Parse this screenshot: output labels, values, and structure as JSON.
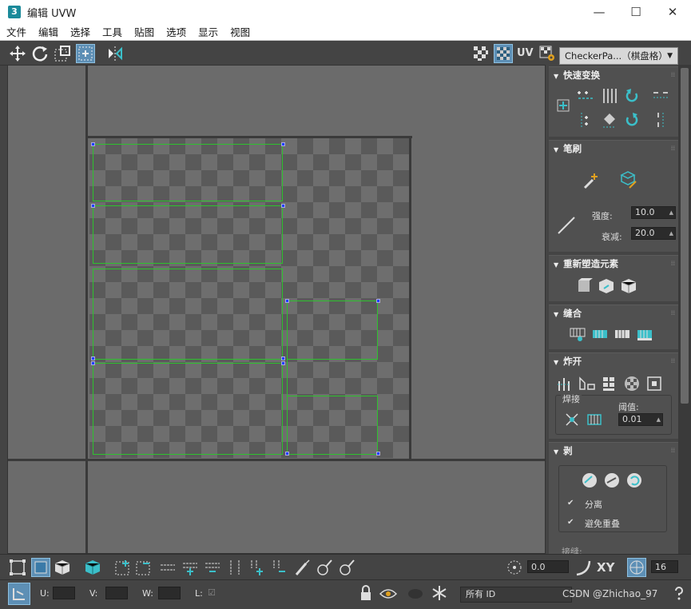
{
  "window": {
    "app_icon_label": "3",
    "title": "编辑 UVW",
    "controls": {
      "minimize": "—",
      "maximize": "☐",
      "close": "✕"
    }
  },
  "menu": [
    "文件",
    "编辑",
    "选择",
    "工具",
    "贴图",
    "选项",
    "显示",
    "视图"
  ],
  "top_toolbar": {
    "uv_label": "UV",
    "checker_select": "CheckerPa...（棋盘格）"
  },
  "panel": {
    "quick_transform": {
      "title": "快速变换"
    },
    "brush": {
      "title": "笔刷",
      "strength_label": "强度:",
      "strength_value": "10.0",
      "falloff_label": "衰减:",
      "falloff_value": "20.0"
    },
    "reshape": {
      "title": "重新塑造元素"
    },
    "stitch": {
      "title": "缝合"
    },
    "explode": {
      "title": "炸开",
      "weld_label": "焊接",
      "threshold_label": "阈值:",
      "threshold_value": "0.01"
    },
    "peel": {
      "title": "剥",
      "detach_label": "分离",
      "avoid_overlap_label": "避免重叠",
      "detach_checked": true,
      "avoid_overlap_checked": true,
      "truncated_label": "接缝:"
    }
  },
  "bottom_bar1": {
    "rotation_value": "0.0",
    "xy_label": "XY",
    "grid_value": "16"
  },
  "bottom_bar2": {
    "u_label": "U:",
    "v_label": "V:",
    "w_label": "W:",
    "l_label": "L:",
    "id_select": "所有 ID"
  },
  "watermark": "CSDN @Zhichao_97",
  "colors": {
    "viewport_bg": "#6b6b6b",
    "uv_border": "#2ec22e",
    "vertex": "#1f3fff",
    "accent_teal": "#3bbfc9"
  }
}
